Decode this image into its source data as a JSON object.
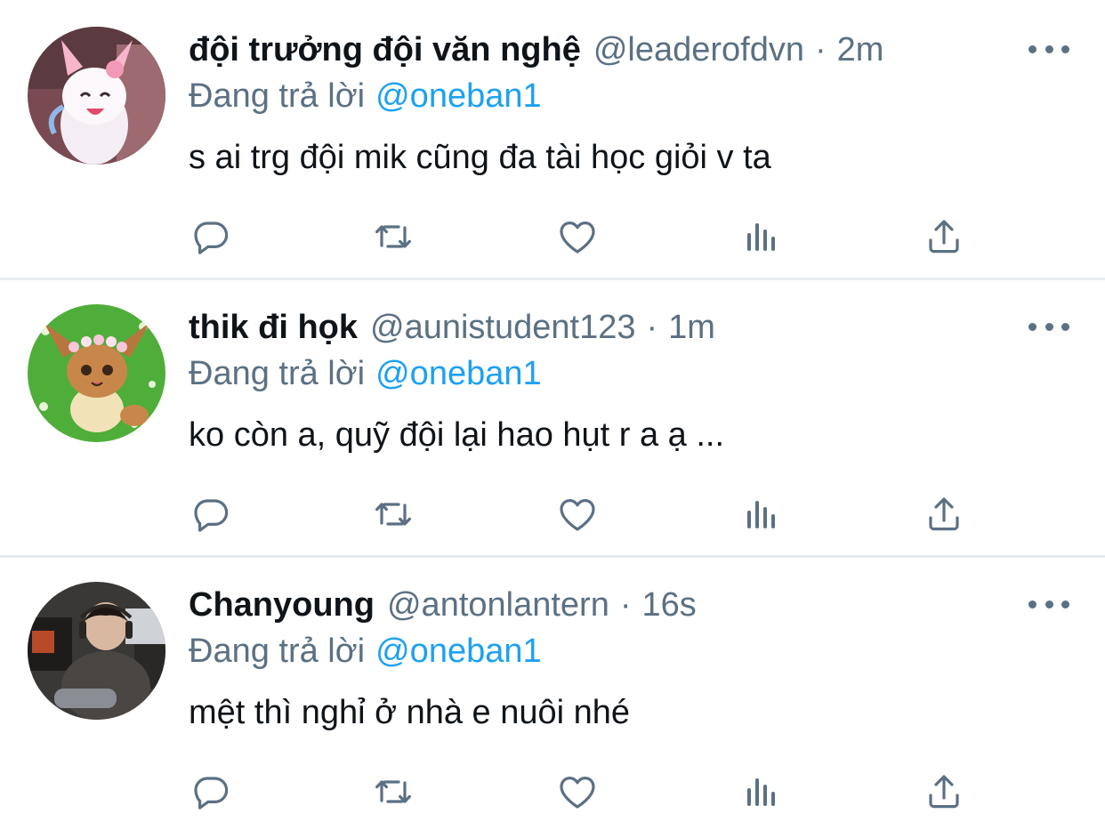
{
  "colors": {
    "text_primary": "#0f1419",
    "text_secondary": "#5b7083",
    "accent": "#1da1f2",
    "divider": "#e6ecf0"
  },
  "icons": {
    "reply": "reply-icon",
    "retweet": "retweet-icon",
    "like": "heart-icon",
    "stats": "analytics-icon",
    "share": "share-icon",
    "more": "more-options-icon"
  },
  "separator": "·",
  "tweets": [
    {
      "display_name": "đội trưởng đội văn nghệ",
      "handle": "@leaderofdvn",
      "time": "2m",
      "replying_prefix": "Đang trả lời",
      "replying_to": "@oneban1",
      "text": "s ai trg đội mik cũng đa tài học giỏi v ta"
    },
    {
      "display_name": "thik đi họk",
      "handle": "@aunistudent123",
      "time": "1m",
      "replying_prefix": "Đang trả lời",
      "replying_to": "@oneban1",
      "text": "ko còn a, quỹ đội lại hao hụt r a ạ ..."
    },
    {
      "display_name": "Chanyoung",
      "handle": "@antonlantern",
      "time": "16s",
      "replying_prefix": "Đang trả lời",
      "replying_to": "@oneban1",
      "text": "mệt thì nghỉ ở nhà e nuôi nhé"
    }
  ]
}
